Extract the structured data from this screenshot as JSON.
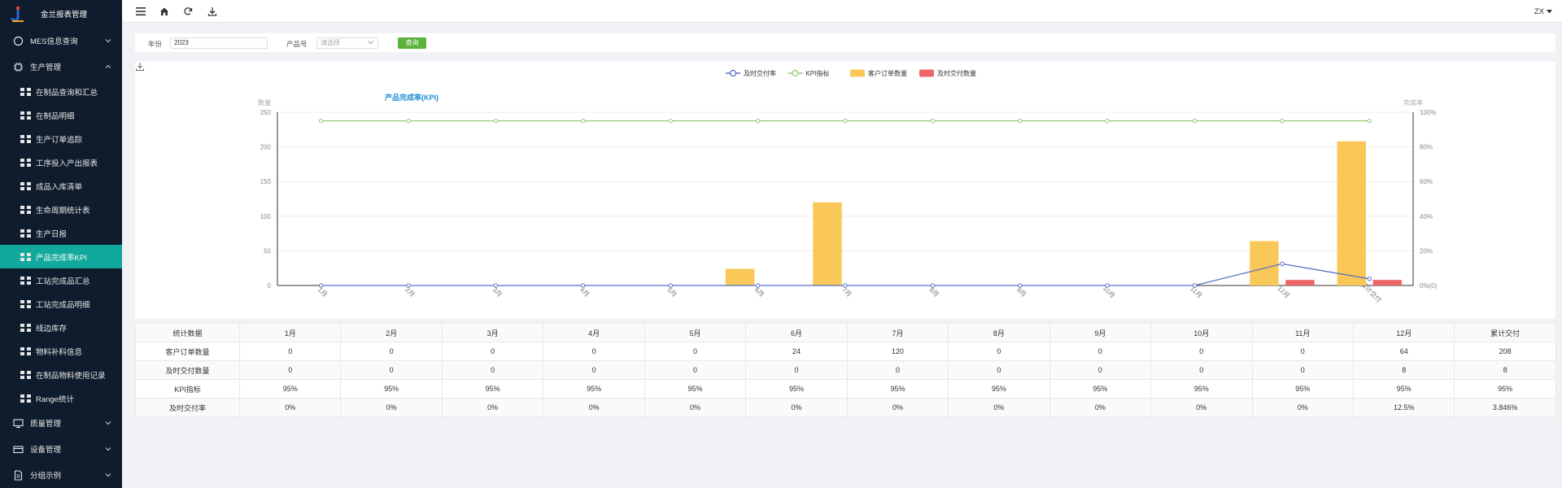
{
  "app": {
    "title": "金兰报表管理"
  },
  "header": {
    "user": "ZX"
  },
  "sidebar": {
    "items": [
      {
        "label": "MES信息查询",
        "type": "group",
        "expanded": false,
        "icon": "search-icon"
      },
      {
        "label": "生产管理",
        "type": "group",
        "expanded": true,
        "icon": "chip-icon"
      },
      {
        "label": "在制品查询和汇总",
        "type": "sub"
      },
      {
        "label": "在制品明细",
        "type": "sub"
      },
      {
        "label": "生产订单追踪",
        "type": "sub"
      },
      {
        "label": "工序投入产出报表",
        "type": "sub"
      },
      {
        "label": "成品入库清单",
        "type": "sub"
      },
      {
        "label": "生命周期统计表",
        "type": "sub"
      },
      {
        "label": "生产日报",
        "type": "sub"
      },
      {
        "label": "产品完成率KPI",
        "type": "sub",
        "active": true
      },
      {
        "label": "工站完成品汇总",
        "type": "sub"
      },
      {
        "label": "工站完成品明细",
        "type": "sub"
      },
      {
        "label": "线边库存",
        "type": "sub"
      },
      {
        "label": "物料补料信息",
        "type": "sub"
      },
      {
        "label": "在制品物料使用记录",
        "type": "sub"
      },
      {
        "label": "Range统计",
        "type": "sub"
      },
      {
        "label": "质量管理",
        "type": "group",
        "expanded": false,
        "icon": "monitor-icon"
      },
      {
        "label": "设备管理",
        "type": "group",
        "expanded": false,
        "icon": "card-icon"
      },
      {
        "label": "分组示例",
        "type": "group",
        "expanded": false,
        "icon": "document-icon"
      }
    ]
  },
  "filter": {
    "year_label": "年份",
    "year_value": "2023",
    "product_label": "产品号",
    "product_placeholder": "请选择",
    "query_button": "查询"
  },
  "chart_data": {
    "type": "bar",
    "title": "产品完成率(KPI)",
    "categories": [
      "1月",
      "2月",
      "3月",
      "4月",
      "5月",
      "6月",
      "7月",
      "8月",
      "9月",
      "10月",
      "11月",
      "12月",
      "累计交付"
    ],
    "y_left_label": "数量",
    "y_right_label": "完成率",
    "y_left_ticks": [
      "0",
      "50",
      "100",
      "150",
      "200",
      "250"
    ],
    "y_right_ticks": [
      "0%(0)",
      "20%",
      "40%",
      "60%",
      "80%",
      "100%"
    ],
    "ylim_left": [
      0,
      250
    ],
    "ylim_right": [
      0,
      100
    ],
    "legend_position": "top-center",
    "series": [
      {
        "name": "及时交付率",
        "kind": "line",
        "axis": "right",
        "color": "#5470c6",
        "values": [
          0,
          0,
          0,
          0,
          0,
          0,
          0,
          0,
          0,
          0,
          0,
          12.5,
          3.846
        ]
      },
      {
        "name": "KPI指标",
        "kind": "line",
        "axis": "right",
        "color": "#91cc75",
        "values": [
          95,
          95,
          95,
          95,
          95,
          95,
          95,
          95,
          95,
          95,
          95,
          95,
          95
        ]
      },
      {
        "name": "客户订单数量",
        "kind": "bar",
        "axis": "left",
        "color": "#fac858",
        "values": [
          0,
          0,
          0,
          0,
          0,
          24,
          120,
          0,
          0,
          0,
          0,
          64,
          208
        ]
      },
      {
        "name": "及时交付数量",
        "kind": "bar",
        "axis": "left",
        "color": "#ee6666",
        "values": [
          0,
          0,
          0,
          0,
          0,
          0,
          0,
          0,
          0,
          0,
          0,
          8,
          8
        ]
      }
    ]
  },
  "table": {
    "header": [
      "统计数据",
      "1月",
      "2月",
      "3月",
      "4月",
      "5月",
      "6月",
      "7月",
      "8月",
      "9月",
      "10月",
      "11月",
      "12月",
      "累计交付"
    ],
    "rows": [
      [
        "客户订单数量",
        "0",
        "0",
        "0",
        "0",
        "0",
        "24",
        "120",
        "0",
        "0",
        "0",
        "0",
        "64",
        "208"
      ],
      [
        "及时交付数量",
        "0",
        "0",
        "0",
        "0",
        "0",
        "0",
        "0",
        "0",
        "0",
        "0",
        "0",
        "8",
        "8"
      ],
      [
        "KPI指标",
        "95%",
        "95%",
        "95%",
        "95%",
        "95%",
        "95%",
        "95%",
        "95%",
        "95%",
        "95%",
        "95%",
        "95%",
        "95%"
      ],
      [
        "及时交付率",
        "0%",
        "0%",
        "0%",
        "0%",
        "0%",
        "0%",
        "0%",
        "0%",
        "0%",
        "0%",
        "0%",
        "12.5%",
        "3.846%"
      ]
    ]
  }
}
